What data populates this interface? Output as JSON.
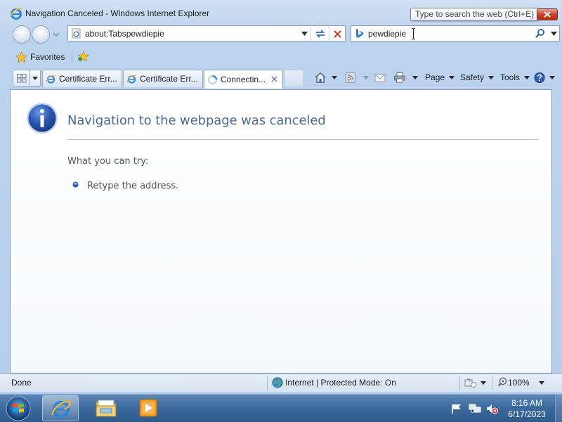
{
  "window": {
    "title": "Navigation Canceled - Windows Internet Explorer"
  },
  "search_tooltip": "Type to search the web (Ctrl+E)",
  "address_bar": {
    "url": "about:Tabspewdiepie"
  },
  "search_bar": {
    "query": "pewdiepie"
  },
  "favorites_bar": {
    "favorites_label": "Favorites"
  },
  "tabs": [
    {
      "label": "Certificate Err...",
      "state": "inactive"
    },
    {
      "label": "Certificate Err...",
      "state": "inactive"
    },
    {
      "label": "Connectin...",
      "state": "active"
    }
  ],
  "command_bar": {
    "page_label": "Page",
    "safety_label": "Safety",
    "tools_label": "Tools"
  },
  "content": {
    "heading": "Navigation to the webpage was canceled",
    "what_you_can_try": "What you can try:",
    "suggestions": [
      "Retype the address."
    ]
  },
  "status_bar": {
    "status": "Done",
    "zone": "Internet | Protected Mode: On",
    "zoom": "100%"
  },
  "taskbar": {
    "time": "8:16 AM",
    "date": "6/17/2023"
  },
  "colors": {
    "heading_blue": "#4a6a8e",
    "window_frame": "#bcd3ee",
    "taskbar": "#3e6b9e",
    "close_red": "#c7432b"
  }
}
